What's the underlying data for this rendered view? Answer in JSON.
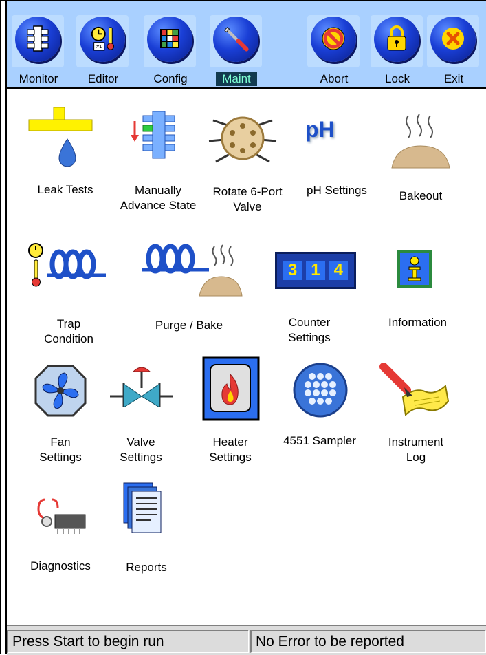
{
  "toolbar": {
    "buttons": [
      {
        "label": "Monitor",
        "icon": "monitor-icon"
      },
      {
        "label": "Editor",
        "icon": "editor-icon"
      },
      {
        "label": "Config",
        "icon": "config-icon"
      },
      {
        "label": "Maint",
        "icon": "wrench-icon",
        "selected": true
      },
      {
        "label": "Abort",
        "icon": "abort-icon"
      },
      {
        "label": "Lock",
        "icon": "lock-icon"
      },
      {
        "label": "Exit",
        "icon": "exit-icon"
      }
    ]
  },
  "maintenance": {
    "items": [
      {
        "label": "Leak Tests",
        "icon": "leak-test-icon"
      },
      {
        "label": "Manually\nAdvance State",
        "icon": "advance-state-icon"
      },
      {
        "label": "Rotate 6-Port\nValve",
        "icon": "six-port-valve-icon"
      },
      {
        "label": "pH Settings",
        "icon": "ph-icon",
        "icon_text": "pH"
      },
      {
        "label": "Bakeout",
        "icon": "bakeout-icon"
      },
      {
        "label": "Trap\nCondition",
        "icon": "trap-condition-icon"
      },
      {
        "label": "Purge / Bake",
        "icon": "purge-bake-icon"
      },
      {
        "label": "Counter\nSettings",
        "icon": "counter-icon",
        "icon_digits": [
          "3",
          "1",
          "4"
        ]
      },
      {
        "label": "Information",
        "icon": "information-icon"
      },
      {
        "label": "Fan\nSettings",
        "icon": "fan-icon"
      },
      {
        "label": "Valve\nSettings",
        "icon": "valve-icon"
      },
      {
        "label": "Heater\nSettings",
        "icon": "heater-icon"
      },
      {
        "label": "4551 Sampler",
        "icon": "sampler-icon"
      },
      {
        "label": "Instrument\nLog",
        "icon": "instrument-log-icon"
      },
      {
        "label": "Diagnostics",
        "icon": "diagnostics-icon"
      },
      {
        "label": "Reports",
        "icon": "reports-icon"
      }
    ]
  },
  "status": {
    "left": "Press Start to begin run",
    "right": "No Error to be reported"
  },
  "colors": {
    "toolbar_bg": "#a9d0ff",
    "orb_blue": "#1a3fd6",
    "selected_label_bg": "#123a4f",
    "selected_label_fg": "#7fffd4",
    "statusbar_bg": "#dcdcdc"
  }
}
